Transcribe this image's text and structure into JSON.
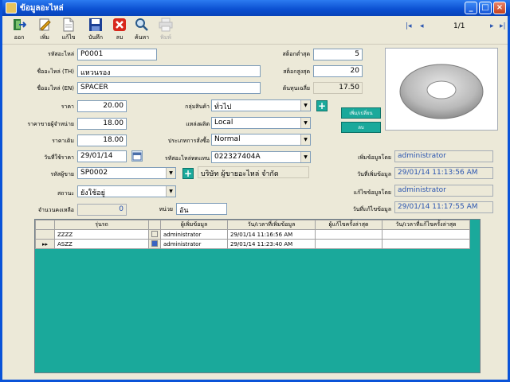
{
  "window": {
    "title": "ข้อมูลอะไหล่"
  },
  "toolbar": {
    "buttons": [
      {
        "label": "ออก",
        "icon": "exit-icon",
        "enabled": true
      },
      {
        "label": "เพิ่ม",
        "icon": "add-icon",
        "enabled": true
      },
      {
        "label": "แก้ไข",
        "icon": "edit-icon",
        "enabled": true
      },
      {
        "label": "บันทึก",
        "icon": "save-icon",
        "enabled": true
      },
      {
        "label": "ลบ",
        "icon": "delete-icon",
        "enabled": true
      },
      {
        "label": "ค้นหา",
        "icon": "search-icon",
        "enabled": true
      },
      {
        "label": "พิมพ์",
        "icon": "print-icon",
        "enabled": false
      }
    ],
    "record_nav": "1/1"
  },
  "form": {
    "part_code": {
      "label": "รหัสอะไหล่",
      "value": "P0001"
    },
    "name_th": {
      "label": "ชื่ออะไหล่ (TH)",
      "value": "แหวนรอง"
    },
    "name_en": {
      "label": "ชื่ออะไหล่ (EN)",
      "value": "SPACER"
    },
    "min_stock": {
      "label": "สต็อกต่ำสุด",
      "value": "5"
    },
    "max_stock": {
      "label": "สต็อกสูงสุด",
      "value": "20"
    },
    "avg_cost": {
      "label": "ต้นทุนเฉลี่ย",
      "value": "17.50"
    },
    "price": {
      "label": "ราคา",
      "value": "20.00"
    },
    "dealer_price": {
      "label": "ราคาขายผู้จำหน่าย",
      "value": "18.00"
    },
    "old_price": {
      "label": "ราคาเดิม",
      "value": "18.00"
    },
    "effective_date": {
      "label": "วันที่ใช้ราคา",
      "value": "29/01/14"
    },
    "vendor_code": {
      "label": "รหัสผู้ขาย",
      "value": "SP0002"
    },
    "vendor_name": "บริษัท ผู้ขายอะไหล่ จำกัด",
    "status": {
      "label": "สถานะ",
      "value": "ยังใช้อยู่"
    },
    "remaining_qty": {
      "label": "จำนวนคงเหลือ",
      "value": "0"
    },
    "unit": {
      "label": "หน่วย",
      "value": "อัน"
    },
    "product_group": {
      "label": "กลุ่มสินค้า",
      "value": "ทั่วไป"
    },
    "origin": {
      "label": "แหล่งผลิต",
      "value": "Local"
    },
    "purchase_type": {
      "label": "ประเภทการสั่งซื้อ",
      "value": "Normal"
    },
    "replacement_code": {
      "label": "รหัสอะไหล่ทดแทน",
      "value": "022327404A"
    },
    "image_buttons": {
      "change": "เพิ่ม/เปลี่ยน",
      "delete": "ลบ"
    }
  },
  "audit": {
    "added_by": {
      "label": "เพิ่มข้อมูลโดย",
      "value": "administrator"
    },
    "added_date": {
      "label": "วันที่เพิ่มข้อมูล",
      "value": "29/01/14 11:13:56 AM"
    },
    "edited_by": {
      "label": "แก้ไขข้อมูลโดย",
      "value": "administrator"
    },
    "edited_date": {
      "label": "วันที่แก้ไขข้อมูล",
      "value": "29/01/14 11:17:55 AM"
    }
  },
  "grid": {
    "columns": [
      "รุ่นรถ",
      "",
      "ผู้เพิ่มข้อมูล",
      "วัน/เวลาที่เพิ่มข้อมูล",
      "ผู้แก้ไขครั้งล่าสุด",
      "วัน/เวลาที่แก้ไขครั้งล่าสุด"
    ],
    "rows": [
      {
        "marker": "",
        "model": "ZZZZ",
        "added_by": "administrator",
        "added_at": "29/01/14 11:16:56 AM",
        "edited_by": "",
        "edited_at": ""
      },
      {
        "marker": "▸▸",
        "model": "ASZZ",
        "added_by": "administrator",
        "added_at": "29/01/14 11:23:40 AM",
        "edited_by": "",
        "edited_at": ""
      }
    ]
  },
  "colors": {
    "accent_teal": "#1aa99b",
    "title_blue": "#0a4fd0",
    "readonly_text": "#2a55b0"
  }
}
